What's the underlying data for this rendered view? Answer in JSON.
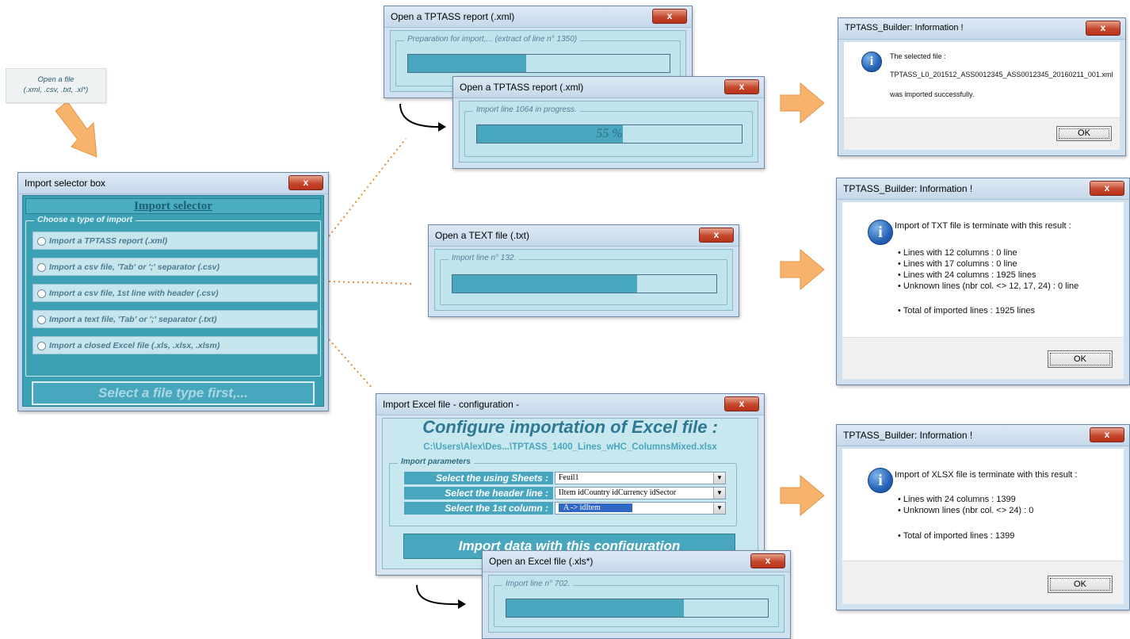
{
  "shortcut": {
    "line1": "Open a file",
    "line2": "(.xml, .csv, .txt, .xl*)"
  },
  "import_selector": {
    "title": "Import selector box",
    "close": "x",
    "header": "Import selector",
    "group_label": "Choose a type of import",
    "options": [
      "Import a TPTASS report  (.xml)",
      "Import a csv file, 'Tab' or ';' separator  (.csv)",
      "Import a csv file, 1st line with header  (.csv)",
      "Import a text file,  'Tab' or ';' separator  (.txt)",
      "Import a closed Excel file  (.xls, .xlsx, .xlsm)"
    ],
    "action_button": "Select a file type first,..."
  },
  "xml_prep": {
    "title": "Open a TPTASS report (.xml)",
    "close": "x",
    "status": "Preparation for import,... (extract of line n° 1350)",
    "progress": 0.45
  },
  "xml_import": {
    "title": "Open a TPTASS report (.xml)",
    "close": "x",
    "status": "Import line  1064 in progress.",
    "progress": 0.55,
    "percent_label": "55 %"
  },
  "txt_import": {
    "title": "Open a TEXT file (.txt)",
    "close": "x",
    "status": "Import line n° 132.",
    "progress": 0.7
  },
  "excel_config": {
    "title": "Import Excel file - configuration -",
    "close": "x",
    "heading": "Configure importation of Excel file :",
    "path": "C:\\Users\\Alex\\Des...\\TPTASS_1400_Lines_wHC_ColumnsMixed.xlsx",
    "group_label": "Import parameters",
    "rows": [
      {
        "label": "Select the using Sheets :",
        "value": "Feuil1"
      },
      {
        "label": "Select the header line :",
        "value": "IItem  idCountry  idCurrency  idSector"
      },
      {
        "label": "Select the 1st column :",
        "value": "A -> idItem"
      }
    ],
    "import_button": "Import data with this configuration"
  },
  "excel_import": {
    "title": "Open an Excel file (.xls*)",
    "close": "x",
    "status": "Import line n° 702.",
    "progress": 0.68
  },
  "info_xml": {
    "title": "TPTASS_Builder: Information !",
    "close": "x",
    "line1": "The selected file :",
    "line2": "TPTASS_L0_201512_ASS0012345_ASS0012345_20160211_001.xml",
    "line3": "was imported successfully.",
    "ok": "OK"
  },
  "info_txt": {
    "title": "TPTASS_Builder: Information !",
    "close": "x",
    "heading": "Import of TXT file is terminate with this result :",
    "lines": [
      "• Lines with 12 columns :  0 line",
      "• Lines with 17 columns :  0 line",
      "• Lines with 24 columns :  1925 lines",
      "• Unknown lines (nbr col. <> 12, 17, 24) :  0 line"
    ],
    "total": "• Total of imported lines :  1925 lines",
    "ok": "OK"
  },
  "info_xlsx": {
    "title": "TPTASS_Builder: Information !",
    "close": "x",
    "heading": "Import of XLSX file is terminate with this result :",
    "lines": [
      "• Lines with 24 columns :  1399",
      "• Unknown lines (nbr col. <> 24) :  0"
    ],
    "total": "• Total of imported lines :  1399",
    "ok": "OK"
  },
  "colors": {
    "accent": "#48a6bf",
    "arrow": "#f7b36b",
    "connector": "#e58a2e",
    "selector_bg": "#3da1b5"
  },
  "icons": [
    "close-icon",
    "info-icon",
    "orange-arrow-icon",
    "curved-arrow-icon",
    "radio-icon",
    "dropdown-arrow-icon"
  ]
}
